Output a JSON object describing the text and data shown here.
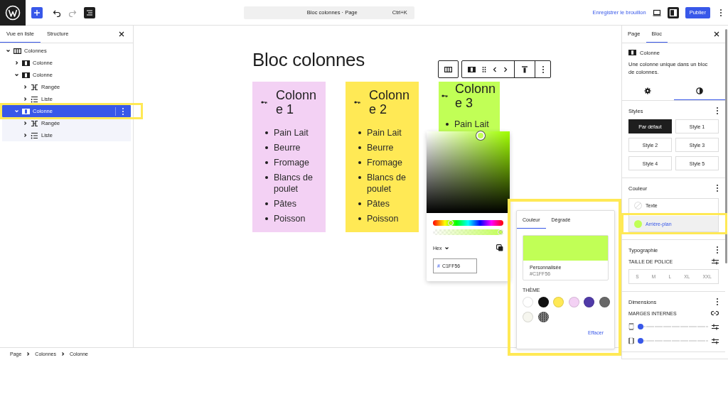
{
  "top_bar": {
    "command_title": "Bloc colonnes · Page",
    "shortcut": "Ctrl+K",
    "save_draft": "Enregistrer le brouillon",
    "publish": "Publier",
    "list_view_open": true,
    "sidebar_open": true
  },
  "list_view": {
    "tabs": [
      {
        "label": "Vue en liste",
        "selected": true
      },
      {
        "label": "Structure",
        "selected": false
      }
    ],
    "tree": [
      {
        "label": "Colonnes",
        "kind": "columns",
        "expanded": true,
        "selected": false,
        "children": [
          {
            "label": "Colonne",
            "kind": "column",
            "expanded": false,
            "selected": false
          },
          {
            "label": "Colonne",
            "kind": "column",
            "expanded": true,
            "selected": false,
            "children": [
              {
                "label": "Rangée",
                "kind": "row",
                "expanded": false,
                "selected": false
              },
              {
                "label": "Liste",
                "kind": "list",
                "expanded": false,
                "selected": false
              }
            ]
          },
          {
            "label": "Colonne",
            "kind": "column",
            "expanded": true,
            "selected": true,
            "children": [
              {
                "label": "Rangée",
                "kind": "row",
                "expanded": false,
                "selected": false
              },
              {
                "label": "Liste",
                "kind": "list",
                "expanded": false,
                "selected": false
              }
            ]
          }
        ]
      }
    ]
  },
  "canvas": {
    "title": "Bloc colonnes",
    "columns": [
      {
        "heading": "Colonne 1",
        "color": "#f3d1f4",
        "items": [
          "Pain Lait",
          "Beurre",
          "Fromage",
          "Blancs de poulet",
          "Pâtes",
          "Poisson"
        ]
      },
      {
        "heading": "Colonne 2",
        "color": "#ffe955",
        "items": [
          "Pain Lait",
          "Beurre",
          "Fromage",
          "Blancs de poulet",
          "Pâtes",
          "Poisson"
        ]
      },
      {
        "heading": "Colonne 3",
        "color": "#c1ff56",
        "items": [
          "Pain Lait"
        ]
      }
    ]
  },
  "color_picker": {
    "format": "Hex",
    "prefix": "#",
    "value": "C1FF56",
    "hue": {
      "level": 0.23
    },
    "alpha": {
      "level": 1
    }
  },
  "color_popover": {
    "tabs": [
      {
        "label": "Couleur",
        "selected": true
      },
      {
        "label": "Dégradé",
        "selected": false
      }
    ],
    "custom": {
      "color": "#c1ff56",
      "label": "Personnalisée",
      "value": "#C1FF56"
    },
    "theme_label": "THÈME",
    "theme": [
      {
        "kind": "solid",
        "color": "#ffffff"
      },
      {
        "kind": "solid",
        "color": "#111111"
      },
      {
        "kind": "solid",
        "color": "#ffe955"
      },
      {
        "kind": "solid",
        "color": "#f3d1f4"
      },
      {
        "kind": "solid",
        "color": "#503aa8"
      },
      {
        "kind": "solid",
        "color": "#686868"
      },
      {
        "kind": "solid",
        "color": "#f6f6ef"
      },
      {
        "kind": "pattern",
        "color": "#888888"
      }
    ],
    "clear": "Effacer"
  },
  "block_settings": {
    "tabs": [
      {
        "label": "Page",
        "selected": false
      },
      {
        "label": "Bloc",
        "selected": true
      }
    ],
    "block": {
      "name": "Colonne",
      "description": "Une colonne unique dans un bloc de colonnes."
    },
    "panels": [
      {
        "kind": "settings",
        "selected": false
      },
      {
        "kind": "styles",
        "selected": true
      }
    ],
    "styles": {
      "title": "Styles",
      "variations": [
        {
          "label": "Par défaut",
          "selected": true
        },
        {
          "label": "Style 1",
          "selected": false
        },
        {
          "label": "Style 2",
          "selected": false
        },
        {
          "label": "Style 3",
          "selected": false
        },
        {
          "label": "Style 4",
          "selected": false
        },
        {
          "label": "Style 5",
          "selected": false
        }
      ]
    },
    "color": {
      "title": "Couleur",
      "items": [
        {
          "label": "Texte",
          "kind": "unset",
          "selected": false
        },
        {
          "label": "Arrière-plan",
          "kind": "swatch",
          "color": "#c1ff56",
          "selected": true
        }
      ]
    },
    "typography": {
      "title": "Typographie",
      "font_size_label": "TAILLE DE POLICE",
      "sizes": [
        "S",
        "M",
        "L",
        "XL",
        "XXL"
      ]
    },
    "dimensions": {
      "title": "Dimensions",
      "padding_label": "MARGES INTERNES",
      "sliders": [
        {
          "kind": "vertical",
          "level": 0
        },
        {
          "kind": "horizontal",
          "level": 0
        }
      ]
    }
  },
  "breadcrumb": [
    "Page",
    "Colonnes",
    "Colonne"
  ]
}
